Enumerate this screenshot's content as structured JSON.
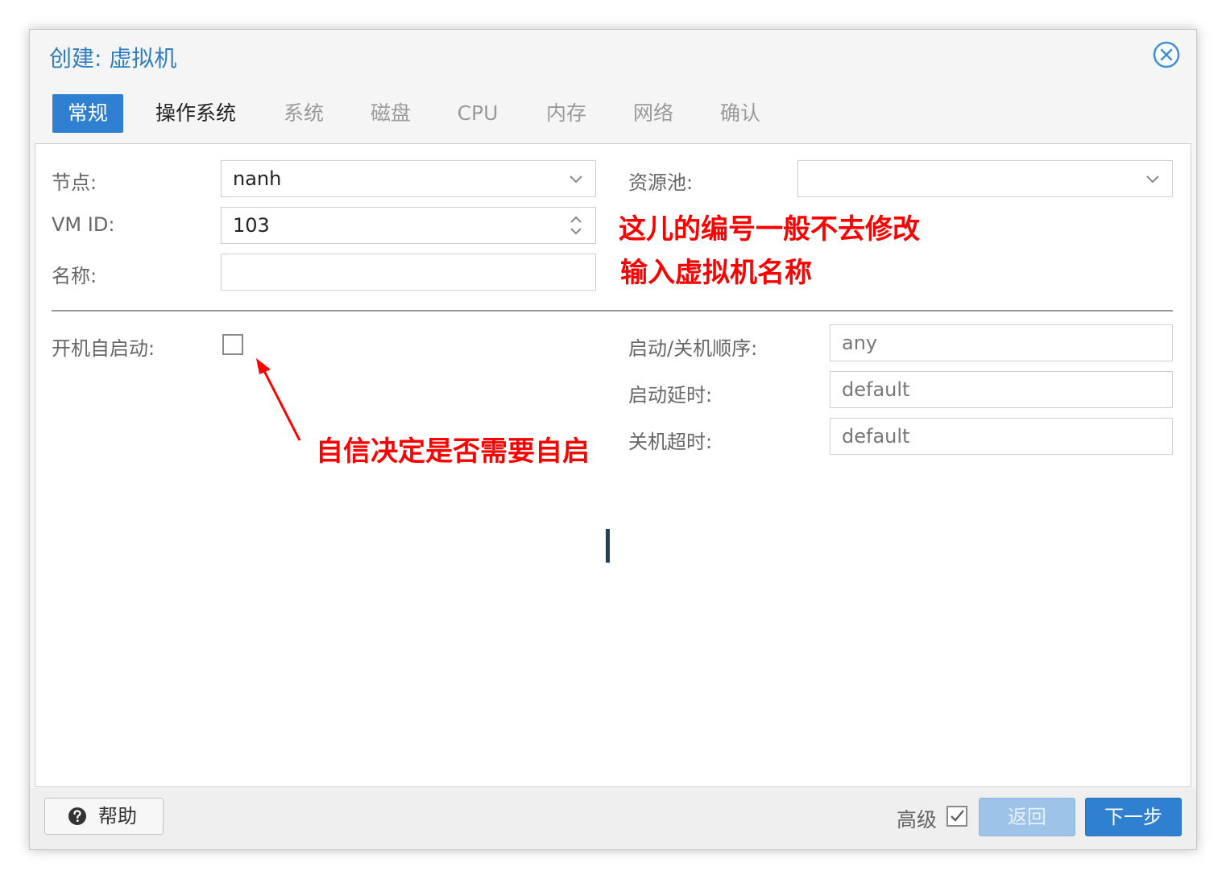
{
  "dialog": {
    "title": "创建: 虚拟机"
  },
  "tabs": [
    {
      "label": "常规",
      "state": "active"
    },
    {
      "label": "操作系统",
      "state": "enabled"
    },
    {
      "label": "系统",
      "state": "disabled"
    },
    {
      "label": "磁盘",
      "state": "disabled"
    },
    {
      "label": "CPU",
      "state": "disabled"
    },
    {
      "label": "内存",
      "state": "disabled"
    },
    {
      "label": "网络",
      "state": "disabled"
    },
    {
      "label": "确认",
      "state": "disabled"
    }
  ],
  "form": {
    "node": {
      "label": "节点:",
      "value": "nanh"
    },
    "vmid": {
      "label": "VM ID:",
      "value": "103"
    },
    "name": {
      "label": "名称:",
      "value": ""
    },
    "pool": {
      "label": "资源池:",
      "value": ""
    },
    "onboot": {
      "label": "开机自启动:",
      "checked": false
    },
    "startup_order": {
      "label": "启动/关机顺序:",
      "placeholder": "any"
    },
    "startup_delay": {
      "label": "启动延时:",
      "placeholder": "default"
    },
    "shutdown_timeout": {
      "label": "关机超时:",
      "placeholder": "default"
    }
  },
  "annotations": {
    "vmid_note": "这儿的编号一般不去修改",
    "name_note": "输入虚拟机名称",
    "onboot_note": "自信决定是否需要自启"
  },
  "footer": {
    "help_label": "帮助",
    "advanced_label": "高级",
    "advanced_checked": true,
    "back_label": "返回",
    "next_label": "下一步"
  },
  "colors": {
    "accent": "#2f80d1",
    "annotation": "#ff0000"
  }
}
